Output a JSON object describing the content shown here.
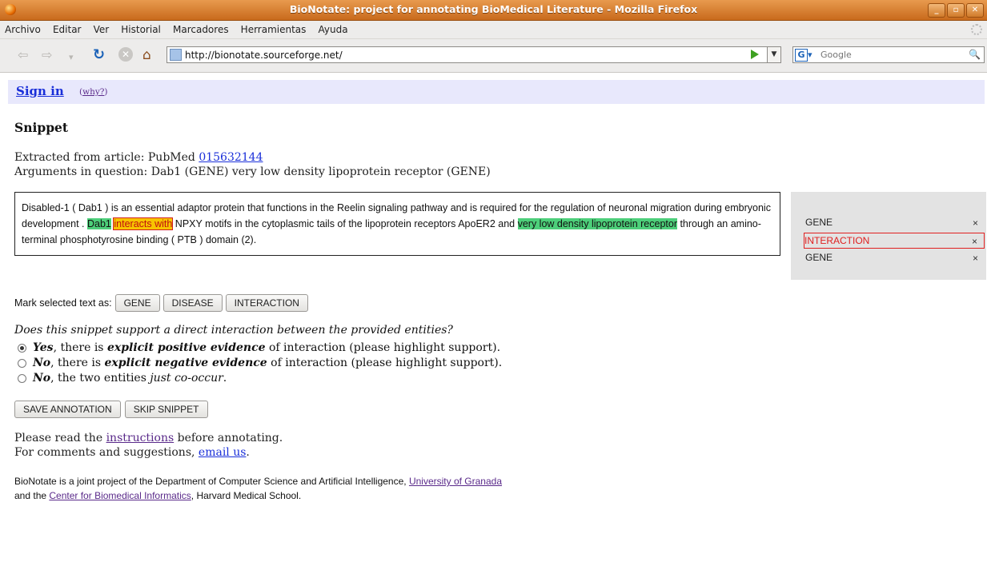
{
  "window": {
    "title": "BioNotate: project for annotating BioMedical Literature - Mozilla Firefox"
  },
  "menu": [
    "Archivo",
    "Editar",
    "Ver",
    "Historial",
    "Marcadores",
    "Herramientas",
    "Ayuda"
  ],
  "navbar": {
    "url": "http://bionotate.sourceforge.net/",
    "search_placeholder": "Google"
  },
  "signin": {
    "label": "Sign in",
    "why_open": "(",
    "why_label": "why?",
    "why_close": ")"
  },
  "snippet": {
    "heading": "Snippet",
    "extracted_prefix": "Extracted from article: PubMed ",
    "pubmed_id": "015632144",
    "arguments": "Arguments in question: Dab1 (GENE) very low density lipoprotein receptor (GENE)",
    "text_1": "Disabled-1 ( Dab1 ) is an essential adaptor protein that functions in the Reelin signaling pathway and is required for the regulation of neuronal migration during embryonic development . ",
    "gene_1": "Dab1",
    "interaction": "interacts with",
    "text_2": " NPXY motifs in the cytoplasmic tails of the lipoprotein receptors ApoER2 and ",
    "gene_2": "very low density lipoprotein receptor",
    "text_3": " through an amino-terminal phosphotyrosine binding ( PTB ) domain (2)."
  },
  "annotations": [
    {
      "label": "GENE",
      "remove": "×"
    },
    {
      "label": "INTERACTION",
      "remove": "×"
    },
    {
      "label": "GENE",
      "remove": "×"
    }
  ],
  "mark": {
    "label": "Mark selected text as:",
    "buttons": [
      "GENE",
      "DISEASE",
      "INTERACTION"
    ]
  },
  "question": {
    "text": "Does this snippet support a direct interaction between the provided entities?",
    "selected_index": 0,
    "options": [
      {
        "lead": "Yes",
        "mid": ", there is ",
        "em": "explicit positive evidence",
        "tail": " of interaction (please highlight support)."
      },
      {
        "lead": "No",
        "mid": ", there is ",
        "em": "explicit negative evidence",
        "tail": " of interaction (please highlight support)."
      },
      {
        "lead": "No",
        "mid": ", the two entities ",
        "em": "just co-occur",
        "tail": "."
      }
    ]
  },
  "actions": {
    "save": "SAVE ANNOTATION",
    "skip": "SKIP SNIPPET"
  },
  "footer": {
    "read_prefix": "Please read the ",
    "instructions": "instructions",
    "read_suffix": " before annotating.",
    "comments_prefix": "For comments and suggestions, ",
    "email": "email us",
    "comments_suffix": ".",
    "credits_1": "BioNotate is a joint project of the Department of Computer Science and Artificial Intelligence, ",
    "granada": "University of Granada",
    "credits_2_prefix": "and the ",
    "cbmi": "Center for Biomedical Informatics",
    "credits_2_suffix": ", Harvard Medical School."
  }
}
